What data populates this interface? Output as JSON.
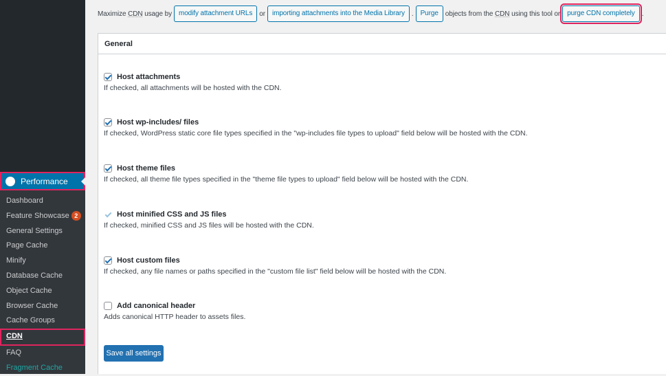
{
  "sidebar": {
    "menu": "Performance",
    "items": [
      {
        "label": "Dashboard"
      },
      {
        "label": "Feature Showcase",
        "badge": "2"
      },
      {
        "label": "General Settings"
      },
      {
        "label": "Page Cache"
      },
      {
        "label": "Minify"
      },
      {
        "label": "Database Cache"
      },
      {
        "label": "Object Cache"
      },
      {
        "label": "Browser Cache"
      },
      {
        "label": "Cache Groups"
      },
      {
        "label": "CDN",
        "current": true
      },
      {
        "label": "FAQ"
      },
      {
        "label": "Fragment Cache"
      }
    ]
  },
  "topbar": {
    "t1": "Maximize",
    "t1b": "CDN",
    "t1c": "usage by",
    "b1": "modify attachment URLs",
    "t2": "or",
    "b2": "importing attachments into the Media Library",
    "t3": ".",
    "b3": "Purge",
    "t4": "objects from the",
    "t4b": "CDN",
    "t4c": "using this tool or",
    "b4": "purge CDN completely",
    "t5": "."
  },
  "panel": {
    "title": "General",
    "save": "Save all settings",
    "options": [
      {
        "label": "Host attachments",
        "desc": "If checked, all attachments will be hosted with the CDN.",
        "checked": true
      },
      {
        "label": "Host wp-includes/ files",
        "desc": "If checked, WordPress static core file types specified in the \"wp-includes file types to upload\" field below will be hosted with the CDN.",
        "checked": true
      },
      {
        "label": "Host theme files",
        "desc": "If checked, all theme file types specified in the \"theme file types to upload\" field below will be hosted with the CDN.",
        "checked": true
      },
      {
        "label": "Host minified CSS and JS files",
        "desc": "If checked, minified CSS and JS files will be hosted with the CDN.",
        "checked": true,
        "disabled": true
      },
      {
        "label": "Host custom files",
        "desc": "If checked, any file names or paths specified in the \"custom file list\" field below will be hosted with the CDN.",
        "checked": true
      },
      {
        "label": "Add canonical header",
        "desc": "Adds canonical HTTP header to assets files.",
        "checked": false
      }
    ]
  }
}
